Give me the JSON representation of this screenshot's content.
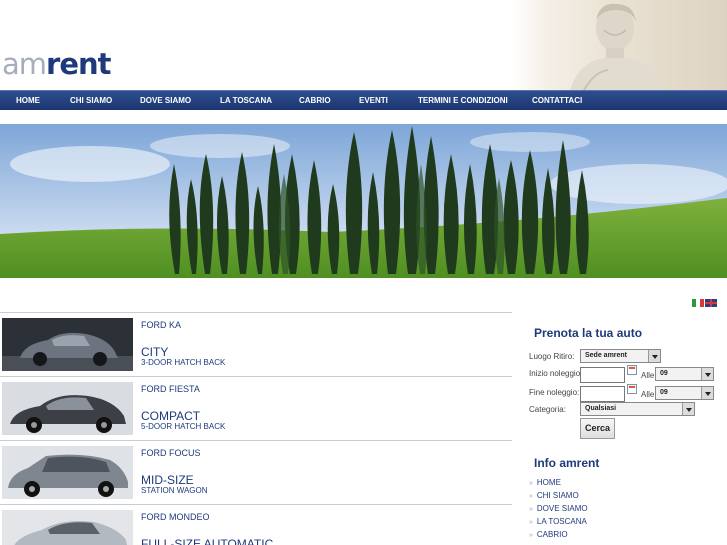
{
  "logo": {
    "part1": "am",
    "part2": "rent"
  },
  "nav": [
    "HOME",
    "CHI SIAMO",
    "DOVE SIAMO",
    "LA TOSCANA",
    "CABRIO",
    "EVENTI",
    "TERMINI E CONDIZIONI",
    "CONTATTACI"
  ],
  "cars": [
    {
      "model": "FORD KA",
      "category": "CITY",
      "body": "3-DOOR HATCH BACK"
    },
    {
      "model": "FORD FIESTA",
      "category": "COMPACT",
      "body": "5-DOOR HATCH BACK"
    },
    {
      "model": "FORD FOCUS",
      "category": "MID-SIZE",
      "body": "STATION WAGON"
    },
    {
      "model": "FORD MONDEO",
      "category": "FULL-SIZE AUTOMATIC",
      "body": ""
    }
  ],
  "booking": {
    "title": "Prenota la tua auto",
    "pickup_label": "Luogo Ritiro:",
    "pickup_value": "Sede amrent",
    "start_label": "Inizio noleggio:",
    "start_hour_label": "Alle",
    "start_hour_value": "09",
    "end_label": "Fine noleggio:",
    "end_hour_label": "Alle",
    "end_hour_value": "09",
    "category_label": "Categoria:",
    "category_value": "Qualsiasi",
    "search_button": "Cerca"
  },
  "info": {
    "title": "Info amrent",
    "links": [
      "HOME",
      "CHI SIAMO",
      "DOVE SIAMO",
      "LA TOSCANA",
      "CABRIO"
    ]
  },
  "colors": {
    "brand_blue": "#1f3a7a",
    "nav_blue": "#1c3570",
    "logo_grey": "#a7adbd"
  },
  "icons": [
    "flag-italy-icon",
    "flag-uk-icon",
    "calendar-icon",
    "dropdown-arrow-icon"
  ]
}
